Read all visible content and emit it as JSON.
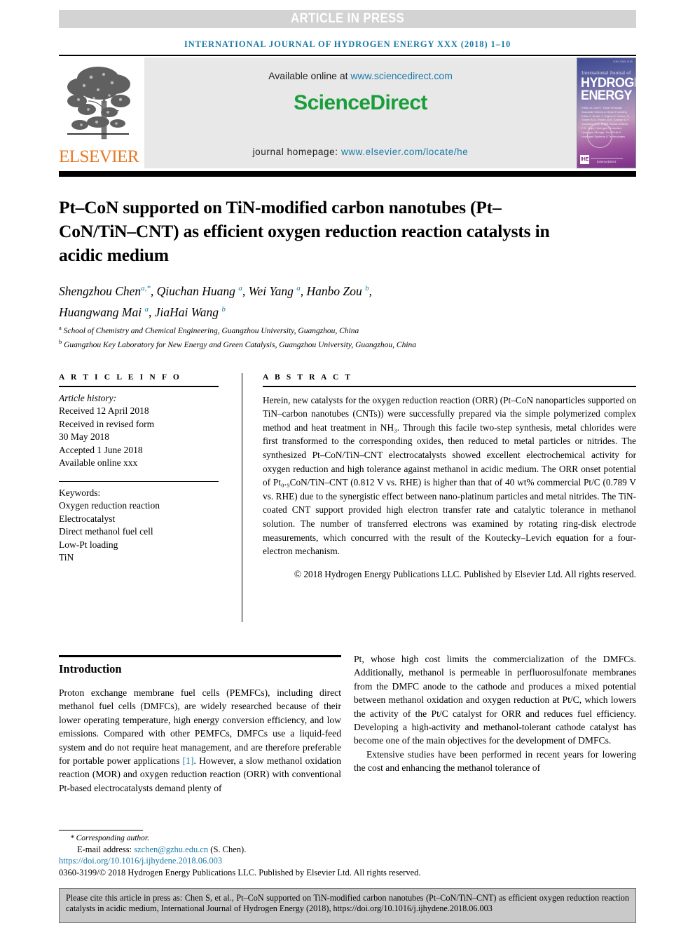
{
  "banner": {
    "text": "ARTICLE IN PRESS",
    "bg_color": "#d3d3d3",
    "text_color": "#ffffff"
  },
  "running_head": "INTERNATIONAL JOURNAL OF HYDROGEN ENERGY XXX (2018) 1–10",
  "masthead": {
    "publisher": "ELSEVIER",
    "publisher_color": "#e87722",
    "available_label": "Available online at",
    "available_url": "www.sciencedirect.com",
    "brand": "ScienceDirect",
    "brand_color": "#1a9e3b",
    "homepage_label": "journal homepage:",
    "homepage_url": "www.elsevier.com/locate/he",
    "link_color": "#1a7aa8",
    "cover": {
      "top_code": "ISSN 0360-3199",
      "kicker": "International Journal of",
      "line1": "HYDROGEN",
      "line2": "ENERGY",
      "editor_names": "Editor-in-Chief   T. Nejat Veziroglu\nAssociate Editors   A. Bejan\nFounding Editor   F. Barbir, Y. Kojima\n                  K. Hirose, D. Stolten\n                  M.A. Rosen, A.M. Kannan\n                  D.Y. Goswami, S.A. Sherif\nSection Editors   E.E. Kaya, Hydrogen Production\n                  Hydrogen Storage, Fuel Cells &\n                  Hydrogen Systems & Technologies",
      "footer": "ScienceDirect",
      "badge": "IHE"
    }
  },
  "article": {
    "title": "Pt–CoN supported on TiN-modified carbon nanotubes (Pt–CoN/TiN–CNT) as efficient oxygen reduction reaction catalysts in acidic medium",
    "authors_line1": "Shengzhou Chen",
    "authors": [
      {
        "name": "Shengzhou Chen",
        "sup": "a,*"
      },
      {
        "name": "Qiuchan Huang",
        "sup": "a"
      },
      {
        "name": "Wei Yang",
        "sup": "a"
      },
      {
        "name": "Hanbo Zou",
        "sup": "b"
      },
      {
        "name": "Huangwang Mai",
        "sup": "a"
      },
      {
        "name": "JiaHai Wang",
        "sup": "b"
      }
    ],
    "affiliations": [
      {
        "marker": "a",
        "text": "School of Chemistry and Chemical Engineering, Guangzhou University, Guangzhou, China"
      },
      {
        "marker": "b",
        "text": "Guangzhou Key Laboratory for New Energy and Green Catalysis, Guangzhou University, Guangzhou, China"
      }
    ]
  },
  "article_info": {
    "label": "A R T I C L E   I N F O",
    "history_label": "Article history:",
    "history": [
      "Received 12 April 2018",
      "Received in revised form",
      "30 May 2018",
      "Accepted 1 June 2018",
      "Available online xxx"
    ],
    "keywords_label": "Keywords:",
    "keywords": [
      "Oxygen reduction reaction",
      "Electrocatalyst",
      "Direct methanol fuel cell",
      "Low-Pt loading",
      "TiN"
    ]
  },
  "abstract": {
    "label": "A B S T R A C T",
    "body": "Herein, new catalysts for the oxygen reduction reaction (ORR) (Pt–CoN nanoparticles supported on TiN–carbon nanotubes (CNTs)) were successfully prepared via the simple polymerized complex method and heat treatment in NH₃. Through this facile two-step synthesis, metal chlorides were first transformed to the corresponding oxides, then reduced to metal particles or nitrides. The synthesized Pt–CoN/TiN–CNT electrocatalysts showed excellent electrochemical activity for oxygen reduction and high tolerance against methanol in acidic medium. The ORR onset potential of Pt₀.₉CoN/TiN–CNT (0.812 V vs. RHE) is higher than that of 40 wt% commercial Pt/C (0.789 V vs. RHE) due to the synergistic effect between nano-platinum particles and metal nitrides. The TiN-coated CNT support provided high electron transfer rate and catalytic tolerance in methanol solution. The number of transferred electrons was examined by rotating ring-disk electrode measurements, which concurred with the result of the Koutecky–Levich equation for a four-electron mechanism.",
    "copyright": "© 2018 Hydrogen Energy Publications LLC. Published by Elsevier Ltd. All rights reserved."
  },
  "introduction": {
    "heading": "Introduction",
    "left_paragraph": "Proton exchange membrane fuel cells (PEMFCs), including direct methanol fuel cells (DMFCs), are widely researched because of their lower operating temperature, high energy conversion efficiency, and low emissions. Compared with other PEMFCs, DMFCs use a liquid-feed system and do not require heat management, and are therefore preferable for portable power applications",
    "reference_marker": "[1]",
    "left_paragraph_cont": ". However, a slow methanol oxidation reaction (MOR) and oxygen reduction reaction (ORR) with conventional Pt-based electrocatalysts demand plenty of",
    "right_paragraph_1": "Pt, whose high cost limits the commercialization of the DMFCs. Additionally, methanol is permeable in perfluorosulfonate membranes from the DMFC anode to the cathode and produces a mixed potential between methanol oxidation and oxygen reduction at Pt/C, which lowers the activity of the Pt/C catalyst for ORR and reduces fuel efficiency. Developing a high-activity and methanol-tolerant cathode catalyst has become one of the main objectives for the development of DMFCs.",
    "right_paragraph_2": "Extensive studies have been performed in recent years for lowering the cost and enhancing the methanol tolerance of"
  },
  "footer": {
    "corresponding": "* Corresponding author.",
    "email_label": "E-mail address:",
    "email": "szchen@gzhu.edu.cn",
    "email_owner": "(S. Chen).",
    "doi": "https://doi.org/10.1016/j.ijhydene.2018.06.003",
    "issn_line": "0360-3199/© 2018 Hydrogen Energy Publications LLC. Published by Elsevier Ltd. All rights reserved."
  },
  "cite_box": {
    "text": "Please cite this article in press as: Chen S, et al., Pt–CoN supported on TiN-modified carbon nanotubes (Pt–CoN/TiN–CNT) as efficient oxygen reduction reaction catalysts in acidic medium, International Journal of Hydrogen Energy (2018), https://doi.org/10.1016/j.ijhydene.2018.06.003",
    "bg_color": "#c9c9c9"
  }
}
